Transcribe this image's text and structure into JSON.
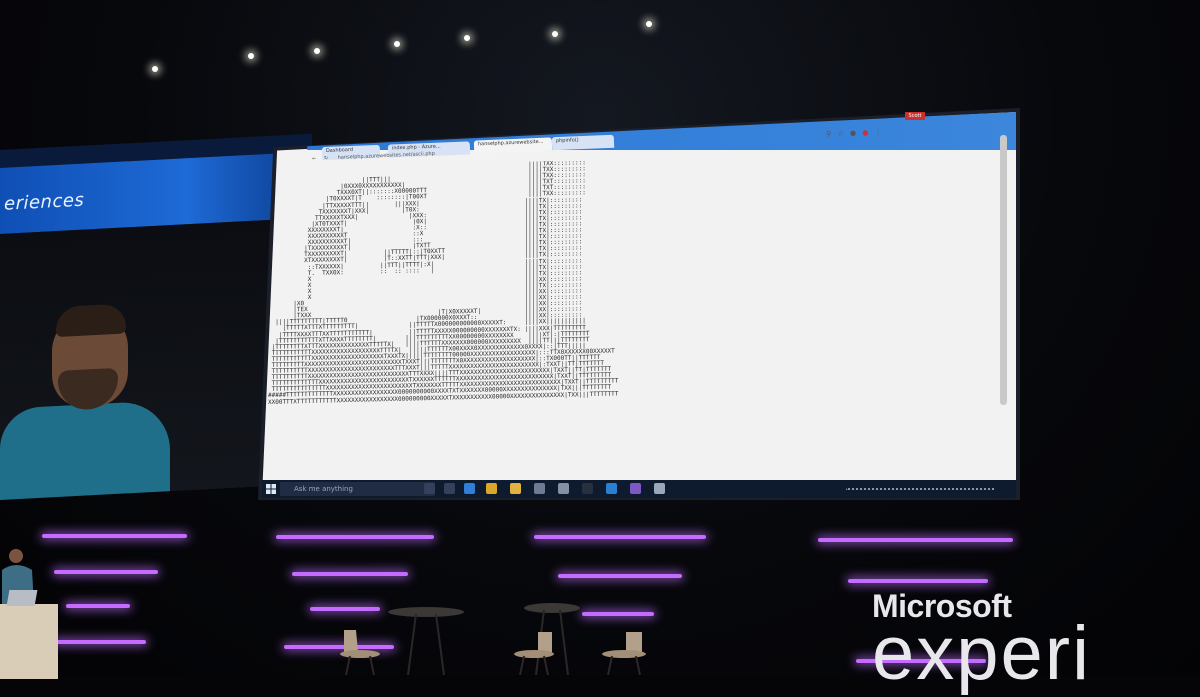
{
  "left_banner": {
    "text": "eriences"
  },
  "browser": {
    "tabs": [
      {
        "label": "Dashboard",
        "active": false
      },
      {
        "label": "index.php - Azure...",
        "active": false
      },
      {
        "label": "hanselphp.azurewebsite...",
        "active": true
      },
      {
        "label": "phpinfo()",
        "active": false
      }
    ],
    "url": "hanselphp.azurewebsites.net/ascii.php",
    "profile_label": "Scott"
  },
  "taskbar": {
    "search_placeholder": "Ask me anything"
  },
  "ascii_lines": [
    "                                                                        ||||TXX:::::::::",
    "                                                                        ||||TXX:::::::::",
    "                          ||TTT|||                                      ||||TXX:::::::::",
    "                    |0XXX0XXXXXXXXXXX|                                  ||||TXT:::::::::",
    "                   TXXX0XT||:::::::X00000TTT                            ||||TXT:::::::::",
    "                |T0XXXXT|T    ::::::::|T00XT                            ||||TXX:::::::::",
    "               |TTXXXXXTTT||       |||XXX|                             ||||TX|:::::::::",
    "              TXXXXXXXT|XXX|         |T0X:                             ||||TX|:::::::::",
    "             TTXXXXXTXXX|              |XXX:                           ||||TX|:::::::::",
    "            |XT0TXXXT|                  |0X|                           ||||TX|:::::::::",
    "           XXXXXXXXT|                   :X::                           ||||TX|:::::::::",
    "           XXXXXXXXXXT                  ::X                            ||||TX|:::::::::",
    "           XXXXXXXXXXT|                 :::                            ||||TX|:::::::::",
    "          |TXXXXXXXXXT|                 |TXTT                          ||||TX|:::::::::",
    "          TXXXXXXXXXT|          ||TTTTT|::|T0XXTT                      ||||TX|:::::::::",
    "          XTXXXXXXXXT|          |T::XXTT|TTT|XXX|                      ||||TX|:::::::::",
    "           ::TXXXXXX|          ||TTT||TTTT|:X|                         ||||TX|:::::::::",
    "           T.  TXX0X:          ::  :: ::::   |                         ||||TX|:::::::::",
    "           X                                                           ||||TX|:::::::::",
    "           X                                                           ||||XX|:::::::::",
    "           X                                                           ||||TX|:::::::::",
    "           X                                                           ||||XX|:::::::::",
    "       |X0                                                             ||||XX|:::::::::",
    "       |TEX                                                            ||||XX|:::::::::",
    "       |TXXX                                   |T|X0XXXXXT|            ||||XX|:::::::::",
    "  ||||TTTTTTTTT|TTTTT0                   |TX000000X0XXXT::             ||||XX|:::::::::",
    "    |TTTTTXTTTXTTTTTTTTT|              ||TTTTTX000000000000XXXXXT:     ||||XX|||||||||||",
    "   |TTTTXXXXTTTXXTTTTTTTTTTT|          ||TTTTTXXXXX000000000XXXXXXXTX: ||||XXX|TTTTTTTTT",
    "  |TTTTTTTTTTTXTTXXXXTTTTTTTT|        |||TTTTTTTTTXX00000000XXXXXXXX    ||||XT|:|TTTTTTTT",
    " |TTTTTTTTXTTTXXXXXXXXXXXXXXTTTTTX|   ||||TTTTTTXXXXXXX000000XXXXXXXXX  ||||TT|||TTTTTTTT",
    " TTTTTTTTTTTXXXXXXXXXXXXXXXXXXXTTTTX|  |||||TTTTTTX00XXXX0XXXXXXXXXXXXX0XXXX|::|TTT|||||",
    " TTTTTTTTTTTXXXXXXXXXXXXXXXXXXXXTXXXTX|||||TTTTTTTT00000XXXXXXXXXXXXXXXXXX|:::TTX0XXXXXX00XXXXXT",
    " TTTTTTTTTXXXXXXXXXXXXXXXXXXXXXXXXXXXTXXXT|||TTTTTTTX0XXXXXXXXXXXXXXXXXXXX|::TX000TT||TTTTTT",
    " TTTTTTTTTTXXXXXXXXXXXXXXXXXXXXXXXXTTTXXXT|||TTTTTXXXXXXXXXXXXXXXXXXXXXXXXX|:TXXT||TT|TTTTTTT",
    " TTTTTTTTTTXXXXXXXXXXXXXXXXXXXXXXXXXXXXTTTXXXX||||TTTXXXXXXXXXXXXXXXXXXXXXXXXX|TXXT||TT|TTTTTTT",
    " TTTTTTTTTTTTTXXXXXXXXXXXXXXXXXXXXXXXXXTXXXXXXTTTTTTXXXXXXXXXXXXXXXXXXXXXXXXXXX|TXXT||TTTTTTTTT",
    " TTTTTTTTTTTTTTTXXXXXXXXXXXXXXXXXXXXXXXXTXXXXXXXTTTTTXXXXXXXXXXXXXXXXXXXXXXXXXXXX|TXXT||TTTTTTTTT",
    "#####TTTTTTTTTTTTTXXXXXXXXXXXXXXXXXX0000000000XXXXTXTXXXXXXX00000XXXXXXXXXXXXXXX|TXX|||TTTTTTTT",
    "XX00TTTXTTTTTTTTTTTXXXXXXXXXXXXXXXXX000000000XXXXXTXXXXXXXXXXX00000XXXXXXXXXXXXXXX|TXX|||TTTTTTTT"
  ],
  "logo": {
    "line1": "Microsoft",
    "line2": "experi"
  }
}
